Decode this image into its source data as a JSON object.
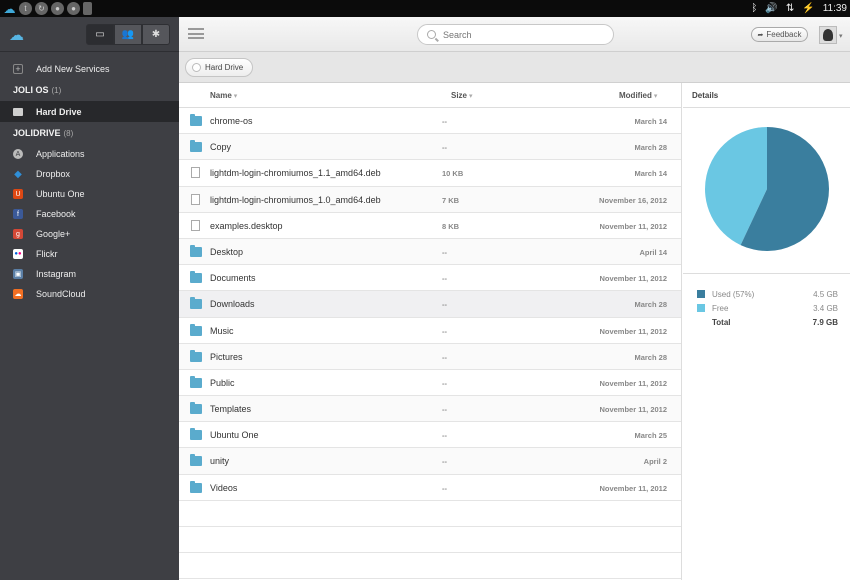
{
  "system_bar": {
    "clock": "11:39"
  },
  "sidebar": {
    "tabs": [
      {
        "icon": "drive-icon"
      },
      {
        "icon": "users-icon"
      },
      {
        "icon": "gear-icon"
      }
    ],
    "add_services_label": "Add New Services",
    "joli_os": {
      "title": "JOLI OS",
      "count": "(1)"
    },
    "hard_drive_label": "Hard Drive",
    "jolidrive": {
      "title": "JOLIDRIVE",
      "count": "(8)"
    },
    "services": [
      {
        "label": "Applications",
        "icon": "applications-icon",
        "color": "#7b7c80"
      },
      {
        "label": "Dropbox",
        "icon": "dropbox-icon",
        "color": "#2f8fd8"
      },
      {
        "label": "Ubuntu One",
        "icon": "ubuntu-one-icon",
        "color": "#dd4814"
      },
      {
        "label": "Facebook",
        "icon": "facebook-icon",
        "color": "#3b5998"
      },
      {
        "label": "Google+",
        "icon": "google-plus-icon",
        "color": "#d34836"
      },
      {
        "label": "Flickr",
        "icon": "flickr-icon",
        "color": "#ffffff"
      },
      {
        "label": "Instagram",
        "icon": "instagram-icon",
        "color": "#5b7fa6"
      },
      {
        "label": "SoundCloud",
        "icon": "soundcloud-icon",
        "color": "#f26f23"
      }
    ]
  },
  "header": {
    "search_placeholder": "Search",
    "feedback_label": "Feedback"
  },
  "breadcrumb": {
    "current": "Hard Drive"
  },
  "files": {
    "columns": {
      "name": "Name",
      "size": "Size",
      "modified": "Modified"
    },
    "rows": [
      {
        "name": "chrome-os",
        "size": "--",
        "modified": "March 14",
        "type": "folder"
      },
      {
        "name": "Copy",
        "size": "--",
        "modified": "March 28",
        "type": "folder"
      },
      {
        "name": "lightdm-login-chromiumos_1.1_amd64.deb",
        "size": "10 KB",
        "modified": "March 14",
        "type": "file"
      },
      {
        "name": "lightdm-login-chromiumos_1.0_amd64.deb",
        "size": "7 KB",
        "modified": "November 16, 2012",
        "type": "file"
      },
      {
        "name": "examples.desktop",
        "size": "8 KB",
        "modified": "November 11, 2012",
        "type": "file"
      },
      {
        "name": "Desktop",
        "size": "--",
        "modified": "April 14",
        "type": "folder"
      },
      {
        "name": "Documents",
        "size": "--",
        "modified": "November 11, 2012",
        "type": "folder"
      },
      {
        "name": "Downloads",
        "size": "--",
        "modified": "March 28",
        "type": "folder",
        "selected": true
      },
      {
        "name": "Music",
        "size": "--",
        "modified": "November 11, 2012",
        "type": "folder"
      },
      {
        "name": "Pictures",
        "size": "--",
        "modified": "March 28",
        "type": "folder"
      },
      {
        "name": "Public",
        "size": "--",
        "modified": "November 11, 2012",
        "type": "folder"
      },
      {
        "name": "Templates",
        "size": "--",
        "modified": "November 11, 2012",
        "type": "folder"
      },
      {
        "name": "Ubuntu One",
        "size": "--",
        "modified": "March 25",
        "type": "folder"
      },
      {
        "name": "unity",
        "size": "--",
        "modified": "April 2",
        "type": "folder"
      },
      {
        "name": "Videos",
        "size": "--",
        "modified": "November 11, 2012",
        "type": "folder"
      }
    ]
  },
  "details": {
    "title": "Details",
    "used": {
      "label": "Used (57%)",
      "value": "4.5 GB",
      "color": "#3a7e9e",
      "fraction": 0.57
    },
    "free": {
      "label": "Free",
      "value": "3.4 GB",
      "color": "#6ac7e3"
    },
    "total": {
      "label": "Total",
      "value": "7.9 GB"
    }
  }
}
